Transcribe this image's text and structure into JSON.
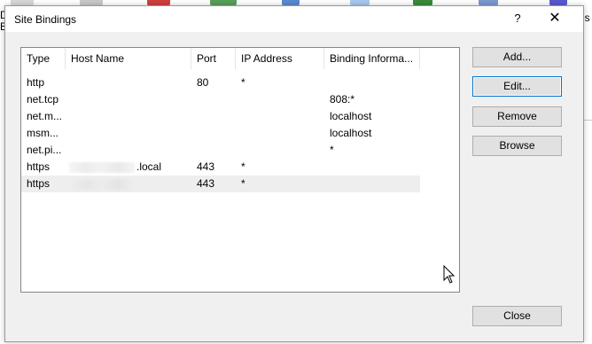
{
  "background": {
    "left_text_1": "D",
    "left_text_2": "B",
    "right_text": "es"
  },
  "dialog": {
    "title": "Site Bindings",
    "help_glyph": "?",
    "close_glyph": "✕"
  },
  "table": {
    "columns": [
      "Type",
      "Host Name",
      "Port",
      "IP Address",
      "Binding Informa..."
    ],
    "rows": [
      {
        "type": "http",
        "host": "",
        "port": "80",
        "ip": "*",
        "binding": ""
      },
      {
        "type": "net.tcp",
        "host": "",
        "port": "",
        "ip": "",
        "binding": "808:*"
      },
      {
        "type": "net.m...",
        "host": "",
        "port": "",
        "ip": "",
        "binding": "localhost"
      },
      {
        "type": "msm...",
        "host": "",
        "port": "",
        "ip": "",
        "binding": "localhost"
      },
      {
        "type": "net.pi...",
        "host": "",
        "port": "",
        "ip": "",
        "binding": "*"
      },
      {
        "type": "https",
        "host": ".local",
        "port": "443",
        "ip": "*",
        "binding": ""
      },
      {
        "type": "https",
        "host": "",
        "port": "443",
        "ip": "*",
        "binding": ""
      }
    ]
  },
  "buttons": {
    "add": "Add...",
    "edit": "Edit...",
    "remove": "Remove",
    "browse": "Browse",
    "close": "Close"
  },
  "colors": {
    "dialog_bg": "#f0f0f0",
    "focus_border": "#0078d7",
    "selected_row": "#eeeeee"
  }
}
